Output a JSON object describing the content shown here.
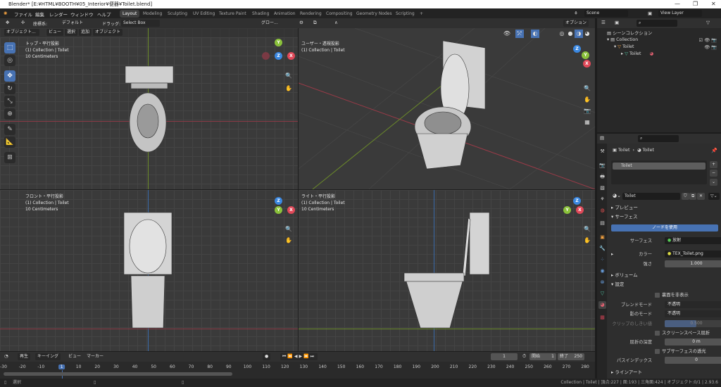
{
  "window": {
    "title": "Blender* [E:¥HTML¥BOOTH¥05_Interior¥便器¥Toilet.blend]",
    "minimize": "—",
    "maximize": "❐",
    "close": "✕"
  },
  "menus": [
    "ファイル",
    "編集",
    "レンダー",
    "ウィンドウ",
    "ヘルプ"
  ],
  "workspaces": [
    "Layout",
    "Modeling",
    "Sculpting",
    "UV Editing",
    "Texture Paint",
    "Shading",
    "Animation",
    "Rendering",
    "Compositing",
    "Geometry Nodes",
    "Scripting",
    "+"
  ],
  "scene": {
    "scene_name": "Scene",
    "view_layer": "View Layer"
  },
  "tool_header": {
    "orientation_label": "座標系:",
    "orientation_value": "デフォルト",
    "drag_label": "ドラッグ:",
    "drag_value": "Select Box",
    "transform": "グロー...",
    "options": "オプション"
  },
  "viewport_header": {
    "mode": "オブジェクト...",
    "view": "ビュー",
    "select": "選択",
    "add": "追加",
    "object": "オブジェクト"
  },
  "viewports": [
    {
      "name": "トップ・平行投影",
      "collection": "(1) Collection | Toilet",
      "scale": "10 Centimeters"
    },
    {
      "name": "ユーザー・透視投影",
      "collection": "(1) Collection | Toilet",
      "scale": ""
    },
    {
      "name": "フロント・平行投影",
      "collection": "(1) Collection | Toilet",
      "scale": "10 Centimeters"
    },
    {
      "name": "ライト・平行投影",
      "collection": "(1) Collection | Toilet",
      "scale": "10 Centimeters"
    }
  ],
  "gizmo_axes": {
    "x": "X",
    "y": "Y",
    "z": "Z"
  },
  "outliner": {
    "root": "シーンコレクション",
    "items": [
      {
        "label": "Collection",
        "level": 1
      },
      {
        "label": "Toilet",
        "level": 2
      },
      {
        "label": "Toilet",
        "level": 3
      }
    ]
  },
  "properties": {
    "object": "Toilet",
    "material": "Toilet",
    "slot": "Toilet",
    "material_name": "Toilet",
    "sections": {
      "preview": "プレビュー",
      "surface": "サーフェス",
      "volume": "ボリューム",
      "settings": "設定",
      "lineart": "ラインアート"
    },
    "use_nodes": "ノードを使用",
    "surface_label": "サーフェス",
    "surface_value": "放射",
    "color_label": "カラー",
    "color_value": "TEX_Toilet.png",
    "strength_label": "強さ",
    "strength_value": "1.000",
    "backface": "裏面を非表示",
    "blend_label": "ブレンドモード",
    "blend_value": "不透明",
    "shadow_label": "影のモード",
    "shadow_value": "不透明",
    "clip_label": "クリップのしきい値",
    "clip_value": "0.500",
    "clip_fraction": 0.5,
    "ss_refraction": "スクリーンスペース屈折",
    "refraction_label": "屈折の深度",
    "refraction_value": "0 m",
    "sss": "サブサーフェスの透光",
    "pass_label": "パスインデックス",
    "pass_value": "0"
  },
  "timeline": {
    "play": "再生",
    "keying": "キーイング",
    "view": "ビュー",
    "marker": "マーカー",
    "current": "1",
    "start_label": "開始",
    "start": "1",
    "end_label": "終了",
    "end": "250",
    "ticks": [
      -30,
      -20,
      -10,
      1,
      10,
      20,
      30,
      40,
      50,
      60,
      70,
      80,
      90,
      100,
      110,
      120,
      130,
      140,
      150,
      160,
      170,
      180,
      190,
      200,
      210,
      220,
      230,
      240,
      250,
      260,
      270,
      280
    ]
  },
  "status": {
    "select": "選択",
    "info": "Collection | Toilet | 頂点:227 | 面:193 | 三角面:424 | オブジェクト:0/1 | 2.93.6"
  },
  "colors": {
    "accent": "#4772b3",
    "x_axis": "#e04858",
    "y_axis": "#8ac13a",
    "z_axis": "#3a87e0"
  }
}
